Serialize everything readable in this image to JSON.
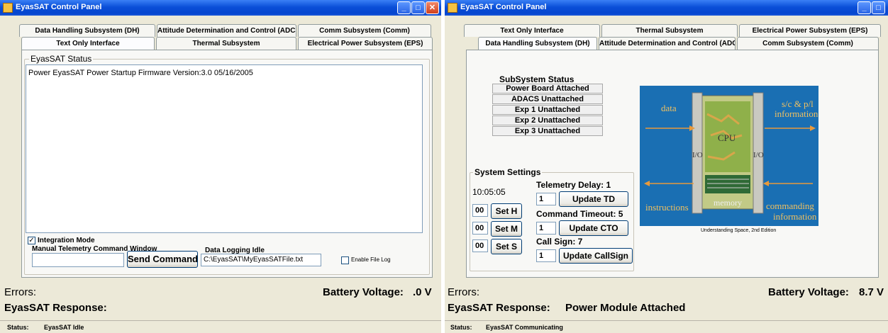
{
  "left_window": {
    "title": "EyasSAT Control Panel",
    "tabs_back": [
      "Data Handling Subsystem (DH)",
      "Attitude Determination and Control (ADCS)",
      "Comm Subsystem (Comm)"
    ],
    "tabs_front": [
      "Text Only Interface",
      "Thermal Subsystem",
      "Electrical Power Subsystem (EPS)"
    ],
    "status_group_label": "EyasSAT Status",
    "status_text": "Power  EyasSAT Power Startup  Firmware Version:3.0 05/16/2005",
    "integration_mode_label": "Integration Mode",
    "integration_mode_checked": true,
    "manual_cmd_label": "Manual Telemetry Command Window",
    "manual_cmd_value": "",
    "send_command_label": "Send Command",
    "data_logging_label": "Data Logging Idle",
    "log_file_path": "C:\\EyasSAT\\MyEyasSATFile.txt",
    "enable_file_log_label": "Enable File Log",
    "errors_label": "Errors:",
    "battery_label": "Battery Voltage:",
    "battery_value": ".0 V",
    "response_label": "EyasSAT Response:",
    "response_value": "",
    "status_bar_label": "Status:",
    "status_bar_value": "EyasSAT Idle"
  },
  "right_window": {
    "title": "EyasSAT Control Panel",
    "tabs_back": [
      "Text Only Interface",
      "Thermal Subsystem",
      "Electrical Power Subsystem (EPS)"
    ],
    "tabs_front": [
      "Data Handling Subsystem (DH)",
      "Attitude Determination and Control (ADCS)",
      "Comm Subsystem (Comm)"
    ],
    "subsystem_status_label": "SubSystem Status",
    "subsystem_items": [
      "Power Board Attached",
      "ADACS Unattached",
      "Exp 1 Unattached",
      "Exp 2 Unattached",
      "Exp 3 Unattached"
    ],
    "settings_label": "System Settings",
    "clock": "10:05:05",
    "hour_value": "00",
    "minute_value": "00",
    "second_value": "00",
    "set_h": "Set H",
    "set_m": "Set M",
    "set_s": "Set S",
    "telemetry_delay_label": "Telemetry Delay: 1",
    "telemetry_delay_value": "1",
    "update_td": "Update TD",
    "command_timeout_label": "Command Timeout: 5",
    "command_timeout_value": "1",
    "update_cto": "Update CTO",
    "call_sign_label": "Call Sign: 7",
    "call_sign_value": "1",
    "update_callsign": "Update CallSign",
    "diagram": {
      "data": "data",
      "sc_info_line1": "s/c & p/l",
      "sc_info_line2": "information",
      "cpu": "CPU",
      "io": "I/O",
      "memory": "memory",
      "instructions": "instructions",
      "commanding_line1": "commanding",
      "commanding_line2": "information",
      "caption": "Understanding Space, 2nd Edition",
      "bg_color": "#1a6fb3"
    },
    "errors_label": "Errors:",
    "battery_label": "Battery Voltage:",
    "battery_value": "8.7 V",
    "response_label": "EyasSAT Response:",
    "response_value": "Power Module Attached",
    "status_bar_label": "Status:",
    "status_bar_value": "EyasSAT Communicating"
  },
  "window_controls": {
    "minimize": "_",
    "maximize": "□",
    "close": "✕"
  }
}
